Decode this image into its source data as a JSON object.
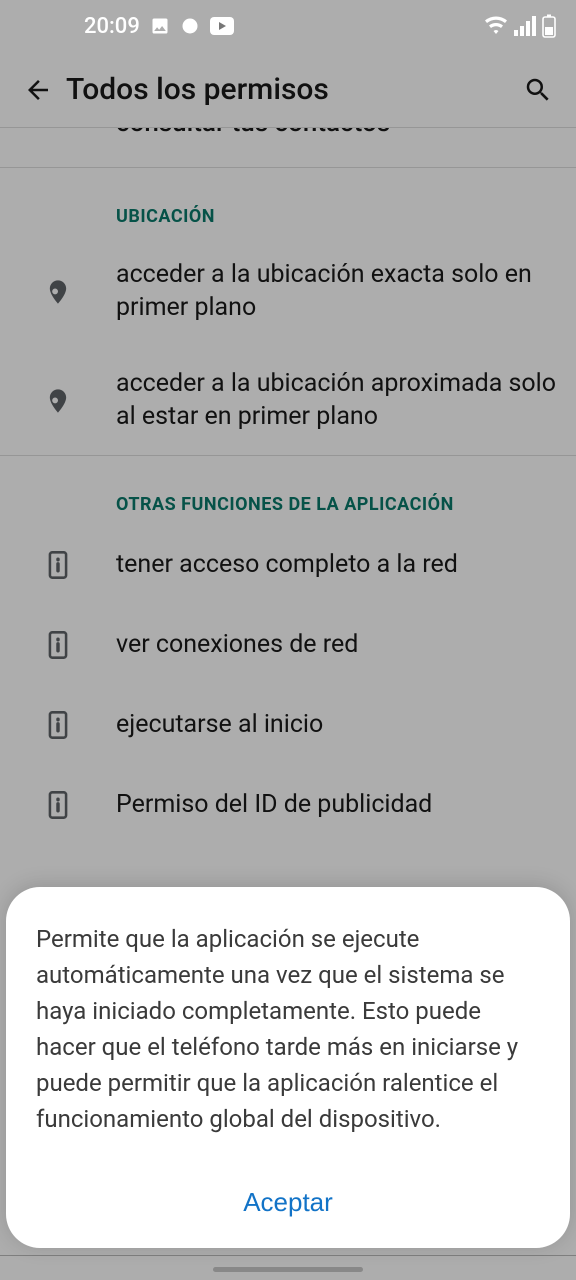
{
  "status": {
    "time": "20:09"
  },
  "header": {
    "title": "Todos los permisos"
  },
  "cutoff_text": "consultar tus contactos",
  "sections": {
    "location": {
      "title": "UBICACIÓN",
      "items": [
        "acceder a la ubicación exacta solo en primer plano",
        "acceder a la ubicación aproximada solo al estar en primer plano"
      ]
    },
    "other": {
      "title": "OTRAS FUNCIONES DE LA APLICACIÓN",
      "items": [
        "tener acceso completo a la red",
        "ver conexiones de red",
        "ejecutarse al inicio",
        "Permiso del ID de publicidad"
      ]
    }
  },
  "dialog": {
    "body": "Permite que la aplicación se ejecute automáticamente una vez que el sistema se haya iniciado completamente. Esto puede hacer que el teléfono tarde más en iniciarse y puede permitir que la aplicación ralentice el funcionamiento global del dispositivo.",
    "accept": "Aceptar"
  }
}
